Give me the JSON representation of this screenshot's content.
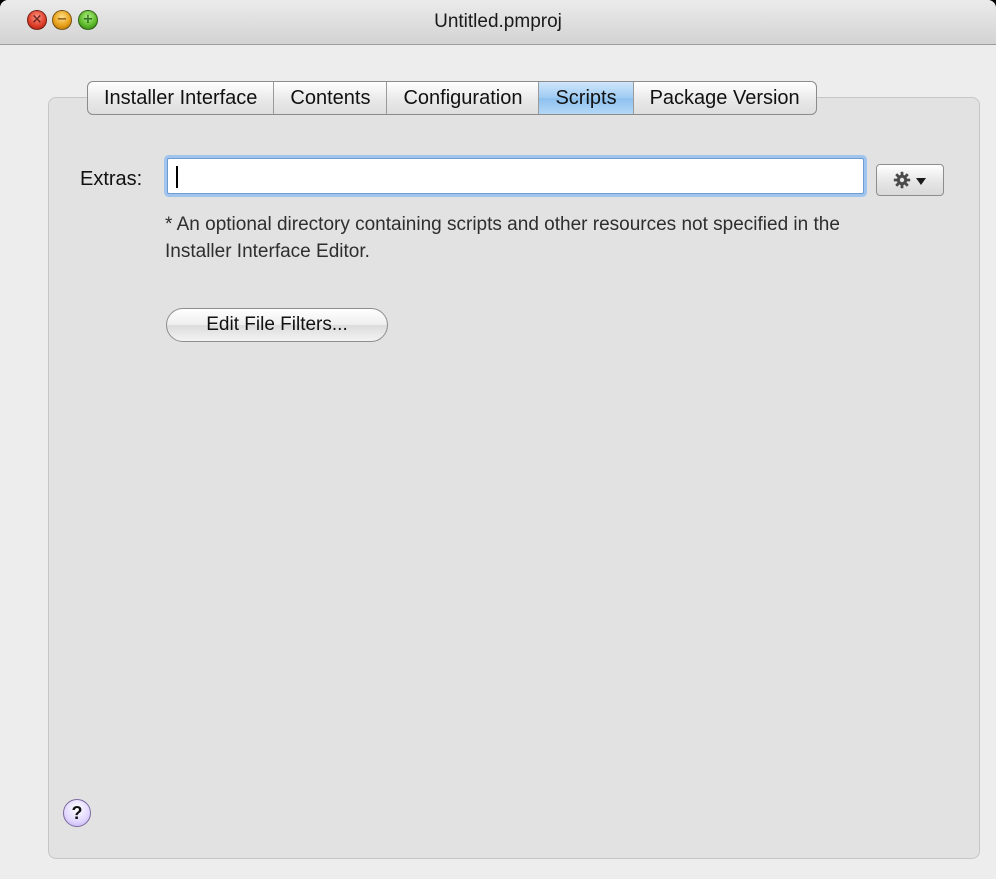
{
  "window": {
    "title": "Untitled.pmproj"
  },
  "tabs": [
    {
      "label": "Installer Interface",
      "active": false
    },
    {
      "label": "Contents",
      "active": false
    },
    {
      "label": "Configuration",
      "active": false
    },
    {
      "label": "Scripts",
      "active": true
    },
    {
      "label": "Package Version",
      "active": false
    }
  ],
  "scripts_panel": {
    "extras_label": "Extras:",
    "extras_value": "",
    "extras_note": "* An optional directory containing scripts and other resources not specified in the Installer Interface Editor.",
    "edit_filters_label": "Edit File Filters...",
    "action_menu_icon": "gear-icon"
  },
  "help": {
    "label": "?"
  },
  "colors": {
    "active_tab": "#9ecbf2",
    "focus_ring": "#9fc4ee",
    "help_button": "#e1d6ff"
  }
}
